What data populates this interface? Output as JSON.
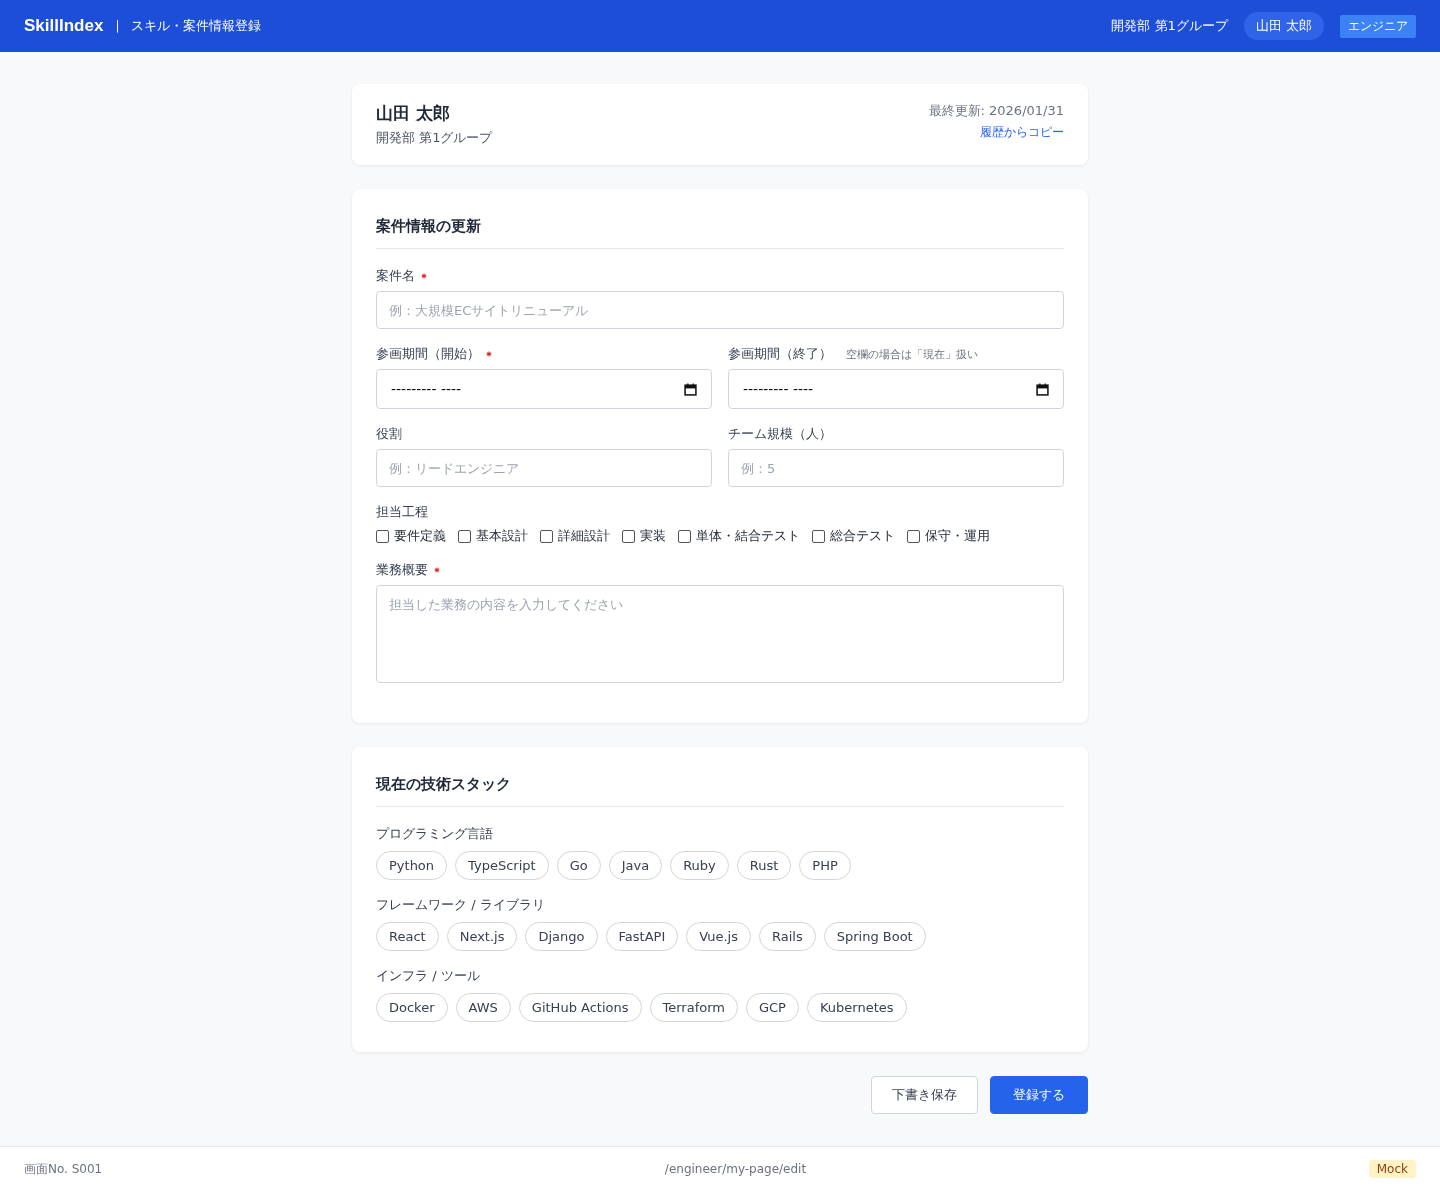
{
  "header": {
    "logo": "SkillIndex",
    "separator": "|",
    "page_title": "スキル・案件情報登録",
    "department": "開発部 第1グループ",
    "user": "山田 太郎",
    "role": "エンジニア"
  },
  "profile": {
    "name": "山田 太郎",
    "department": "開発部 第1グループ",
    "last_updated": "最終更新: 2026/01/31",
    "copy_link": "履歴からコピー"
  },
  "project_form": {
    "title": "案件情報の更新",
    "project_name": {
      "label": "案件名",
      "required": true,
      "placeholder": "例：大規模ECサイトリニューアル"
    },
    "start_date": {
      "label": "参画期間（開始）",
      "required": true,
      "value": "--------- ----"
    },
    "end_date": {
      "label": "参画期間（終了）",
      "hint": "空欄の場合は「現在」扱い",
      "value": "--------- ----"
    },
    "role": {
      "label": "役割",
      "placeholder": "例：リードエンジニア"
    },
    "team_size": {
      "label": "チーム規模（人）",
      "placeholder": "例：5"
    },
    "phases": {
      "label": "担当工程",
      "options": [
        {
          "label": "要件定義",
          "checked": false
        },
        {
          "label": "基本設計",
          "checked": false
        },
        {
          "label": "詳細設計",
          "checked": false
        },
        {
          "label": "実装",
          "checked": false
        },
        {
          "label": "単体・結合テスト",
          "checked": false
        },
        {
          "label": "総合テスト",
          "checked": false
        },
        {
          "label": "保守・運用",
          "checked": false
        }
      ]
    },
    "summary": {
      "label": "業務概要",
      "required": true,
      "placeholder": "担当した業務の内容を入力してください"
    }
  },
  "tech_stack": {
    "title": "現在の技術スタック",
    "groups": [
      {
        "label": "プログラミング言語",
        "tags": [
          {
            "label": "Python",
            "selected": false
          },
          {
            "label": "TypeScript",
            "selected": false
          },
          {
            "label": "Go",
            "selected": false
          },
          {
            "label": "Java",
            "selected": false
          },
          {
            "label": "Ruby",
            "selected": false
          },
          {
            "label": "Rust",
            "selected": false
          },
          {
            "label": "PHP",
            "selected": false
          }
        ]
      },
      {
        "label": "フレームワーク / ライブラリ",
        "tags": [
          {
            "label": "React",
            "selected": false
          },
          {
            "label": "Next.js",
            "selected": false
          },
          {
            "label": "Django",
            "selected": false
          },
          {
            "label": "FastAPI",
            "selected": false
          },
          {
            "label": "Vue.js",
            "selected": false
          },
          {
            "label": "Rails",
            "selected": false
          },
          {
            "label": "Spring Boot",
            "selected": false
          }
        ]
      },
      {
        "label": "インフラ / ツール",
        "tags": [
          {
            "label": "Docker",
            "selected": false
          },
          {
            "label": "AWS",
            "selected": false
          },
          {
            "label": "GitHub Actions",
            "selected": false
          },
          {
            "label": "Terraform",
            "selected": false
          },
          {
            "label": "GCP",
            "selected": false
          },
          {
            "label": "Kubernetes",
            "selected": false
          }
        ]
      }
    ]
  },
  "actions": {
    "draft": "下書き保存",
    "submit": "登録する"
  },
  "footer": {
    "screen_no": "画面No. S001",
    "path": "/engineer/my-page/edit",
    "badge": "Mock"
  }
}
